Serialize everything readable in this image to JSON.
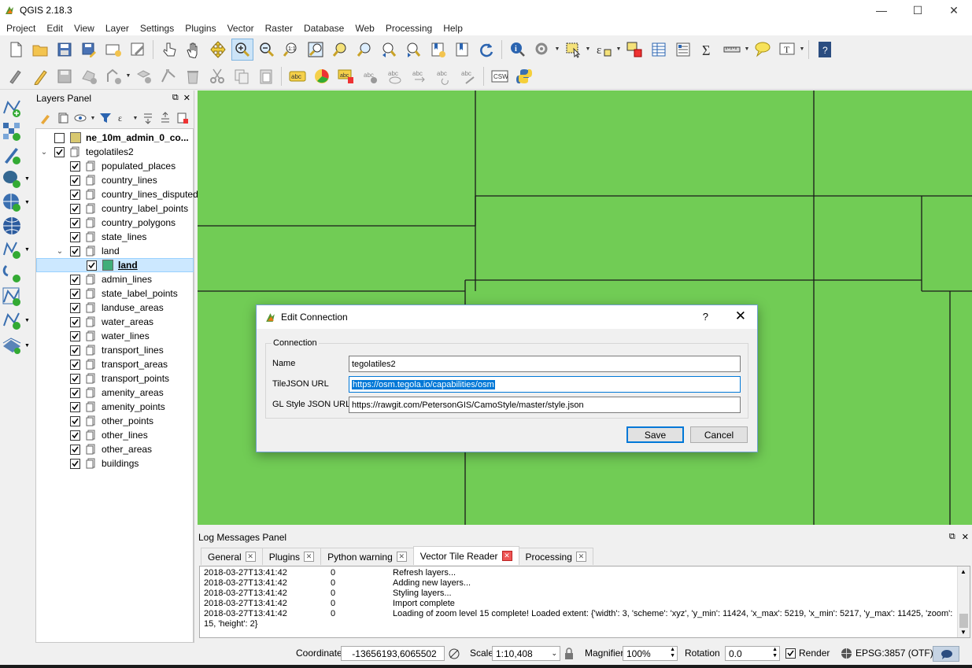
{
  "window": {
    "title": "QGIS 2.18.3",
    "controls": {
      "minimize": "—",
      "maximize": "☐",
      "close": "✕"
    }
  },
  "menubar": [
    "Project",
    "Edit",
    "View",
    "Layer",
    "Settings",
    "Plugins",
    "Vector",
    "Raster",
    "Database",
    "Web",
    "Processing",
    "Help"
  ],
  "toolbar": {
    "row1_icons": [
      "new-project-icon",
      "open-project-icon",
      "save-project-icon",
      "save-as-icon",
      "new-print-composer-icon",
      "composer-manager-icon",
      "touch-zoom-icon",
      "pan-icon",
      "pan-to-selection-icon",
      "zoom-in-icon",
      "zoom-out-icon",
      "zoom-actual-icon",
      "zoom-full-icon",
      "zoom-to-selection-icon",
      "zoom-to-layer-icon",
      "zoom-last-icon",
      "zoom-next-icon",
      "new-bookmark-icon",
      "show-bookmarks-icon",
      "refresh-icon",
      "identify-icon",
      "action-icon",
      "select-features-icon",
      "select-by-expression-icon",
      "deselect-icon",
      "attribute-table-icon",
      "field-calculator-icon",
      "statistics-icon",
      "measure-icon",
      "map-tips-icon",
      "text-annotation-icon",
      "help-icon"
    ],
    "row2_icons": [
      "digitize-icon",
      "toggle-editing-icon",
      "save-edits-icon",
      "add-feature-icon",
      "add-part-icon",
      "move-feature-icon",
      "node-tool-icon",
      "delete-selected-icon",
      "cut-icon",
      "copy-icon",
      "paste-icon",
      "label-icon",
      "diagram-icon",
      "pin-labels-icon",
      "show-hide-labels-icon",
      "move-label-icon",
      "rotate-label-icon",
      "change-label-icon",
      "csw-icon",
      "python-icon"
    ],
    "csw_label": "CSW"
  },
  "left_toolbar": [
    "add-vector-layer-icon",
    "add-raster-layer-icon",
    "add-delimited-text-icon",
    "add-postgis-icon",
    "add-wms-icon",
    "add-wcs-icon",
    "add-wfs-icon",
    "add-virtual-layer-icon",
    "new-shapefile-icon",
    "add-spatialite-icon",
    "add-mssql-icon",
    "add-oracle-icon"
  ],
  "layers_panel": {
    "title": "Layers Panel",
    "layers": [
      {
        "name": "ne_10m_admin_0_co...",
        "level": 0,
        "checked": false,
        "bold": true,
        "icon": "polygon-swatch",
        "swatch": "#d8c870"
      },
      {
        "name": "tegolatiles2",
        "level": 0,
        "checked": true,
        "expanded": true,
        "icon": "group-icon"
      },
      {
        "name": "populated_places",
        "level": 1,
        "checked": true,
        "icon": "group-icon"
      },
      {
        "name": "country_lines",
        "level": 1,
        "checked": true,
        "icon": "group-icon"
      },
      {
        "name": "country_lines_disputed",
        "level": 1,
        "checked": true,
        "icon": "group-icon"
      },
      {
        "name": "country_label_points",
        "level": 1,
        "checked": true,
        "icon": "group-icon"
      },
      {
        "name": "country_polygons",
        "level": 1,
        "checked": true,
        "icon": "group-icon"
      },
      {
        "name": "state_lines",
        "level": 1,
        "checked": true,
        "icon": "group-icon"
      },
      {
        "name": "land",
        "level": 1,
        "checked": true,
        "expanded": true,
        "icon": "group-icon"
      },
      {
        "name": "land",
        "level": 2,
        "checked": true,
        "selected": true,
        "bold": true,
        "icon": "polygon-swatch",
        "swatch": "#3fae79"
      },
      {
        "name": "admin_lines",
        "level": 1,
        "checked": true,
        "icon": "group-icon"
      },
      {
        "name": "state_label_points",
        "level": 1,
        "checked": true,
        "icon": "group-icon"
      },
      {
        "name": "landuse_areas",
        "level": 1,
        "checked": true,
        "icon": "group-icon"
      },
      {
        "name": "water_areas",
        "level": 1,
        "checked": true,
        "icon": "group-icon"
      },
      {
        "name": "water_lines",
        "level": 1,
        "checked": true,
        "icon": "group-icon"
      },
      {
        "name": "transport_lines",
        "level": 1,
        "checked": true,
        "icon": "group-icon"
      },
      {
        "name": "transport_areas",
        "level": 1,
        "checked": true,
        "icon": "group-icon"
      },
      {
        "name": "transport_points",
        "level": 1,
        "checked": true,
        "icon": "group-icon"
      },
      {
        "name": "amenity_areas",
        "level": 1,
        "checked": true,
        "icon": "group-icon"
      },
      {
        "name": "amenity_points",
        "level": 1,
        "checked": true,
        "icon": "group-icon"
      },
      {
        "name": "other_points",
        "level": 1,
        "checked": true,
        "icon": "group-icon"
      },
      {
        "name": "other_lines",
        "level": 1,
        "checked": true,
        "icon": "group-icon"
      },
      {
        "name": "other_areas",
        "level": 1,
        "checked": true,
        "icon": "group-icon"
      },
      {
        "name": "buildings",
        "level": 1,
        "checked": true,
        "icon": "group-icon"
      }
    ]
  },
  "map": {
    "fill_color": "#71cc55",
    "line_color": "#1a1a1a"
  },
  "dialog": {
    "title": "Edit Connection",
    "help": "?",
    "close": "✕",
    "group_label": "Connection",
    "fields": [
      {
        "label": "Name",
        "value": "tegolatiles2",
        "selected": false
      },
      {
        "label": "TileJSON URL",
        "value": "https://osm.tegola.io/capabilities/osm",
        "selected": true
      },
      {
        "label": "GL Style JSON URL",
        "value": "https://rawgit.com/PetersonGIS/CamoStyle/master/style.json",
        "selected": false
      }
    ],
    "save_label": "Save",
    "cancel_label": "Cancel"
  },
  "log_panel": {
    "title": "Log Messages Panel",
    "tabs": [
      {
        "label": "General",
        "active": false
      },
      {
        "label": "Plugins",
        "active": false
      },
      {
        "label": "Python warning",
        "active": false
      },
      {
        "label": "Vector Tile Reader",
        "active": true
      },
      {
        "label": "Processing",
        "active": false
      }
    ],
    "messages": [
      {
        "time": "2018-03-27T13:41:42",
        "level": "0",
        "text": "Refresh layers..."
      },
      {
        "time": "2018-03-27T13:41:42",
        "level": "0",
        "text": "Adding new layers..."
      },
      {
        "time": "2018-03-27T13:41:42",
        "level": "0",
        "text": "Styling layers..."
      },
      {
        "time": "2018-03-27T13:41:42",
        "level": "0",
        "text": "Import complete"
      },
      {
        "time": "2018-03-27T13:41:42",
        "level": "0",
        "text": "Loading of zoom level 15 complete! Loaded extent: {'width': 3, 'scheme': 'xyz', 'y_min': 11424, 'x_max': 5219, 'x_min': 5217, 'y_max': 11425, 'zoom':"
      }
    ],
    "continuation": "15, 'height': 2}"
  },
  "statusbar": {
    "coordinate_label": "Coordinate",
    "coordinate_value": "-13656193,6065502",
    "scale_label": "Scale",
    "scale_value": "1:10,408",
    "magnifier_label": "Magnifier",
    "magnifier_value": "100%",
    "rotation_label": "Rotation",
    "rotation_value": "0.0",
    "render_label": "Render",
    "render_checked": true,
    "crs_label": "EPSG:3857 (OTF)"
  }
}
